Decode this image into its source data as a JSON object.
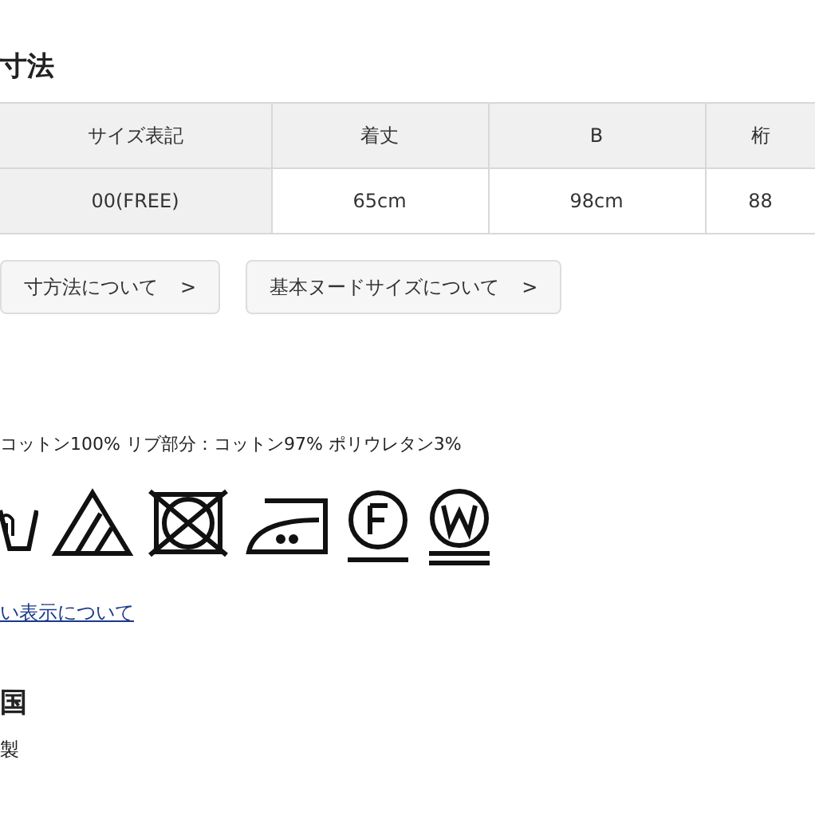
{
  "size_section": {
    "heading": "寸法",
    "table": {
      "columns": [
        "サイズ表記",
        "着丈",
        "B",
        "桁"
      ],
      "rows": [
        [
          "00(FREE)",
          "65cm",
          "98cm",
          "88"
        ]
      ]
    },
    "buttons": [
      {
        "label": "寸方法について",
        "chevron": ">"
      },
      {
        "label": "基本ヌードサイズについて",
        "chevron": ">"
      }
    ]
  },
  "material": {
    "text": "コットン100% リブ部分：コットン97% ポリウレタン3%"
  },
  "care_symbols": [
    {
      "kind": "handwash"
    },
    {
      "kind": "bleach"
    },
    {
      "kind": "no-tumble"
    },
    {
      "kind": "iron"
    },
    {
      "kind": "dry-f"
    },
    {
      "kind": "wet-w"
    }
  ],
  "care_link": "い表示について",
  "origin": {
    "heading": "国",
    "value": "製"
  }
}
